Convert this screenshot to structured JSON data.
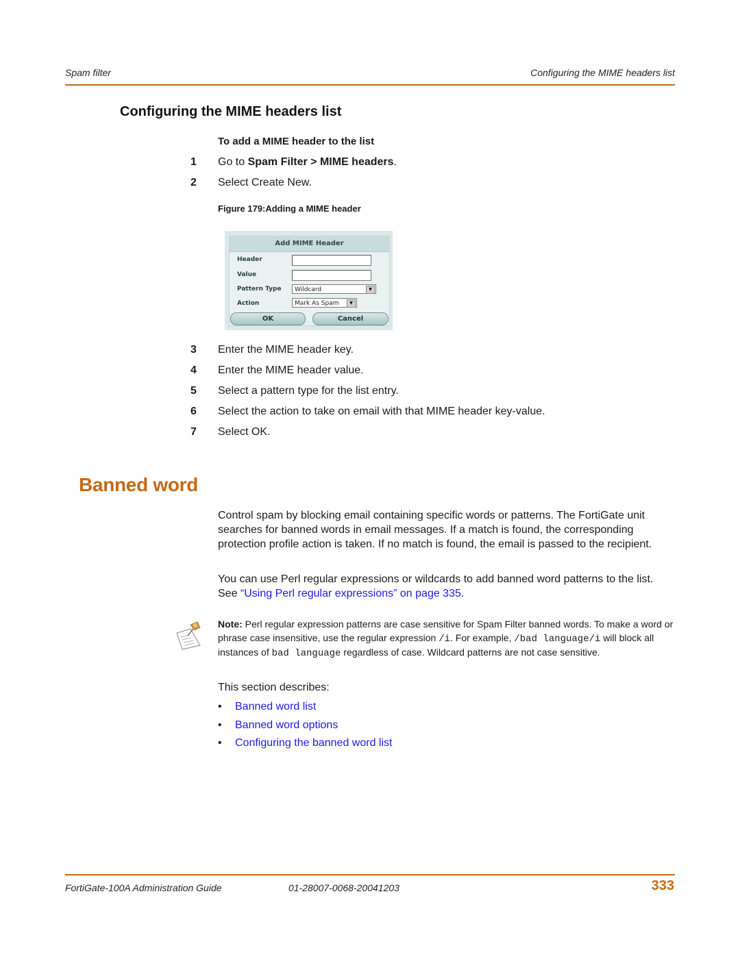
{
  "header": {
    "left": "Spam filter",
    "right": "Configuring the MIME headers list"
  },
  "section": {
    "title": "Configuring the MIME headers list",
    "procedure_title": "To add a MIME header to the list",
    "steps_before": [
      {
        "num": "1",
        "prefix": "Go to ",
        "bold": "Spam Filter > MIME headers",
        "suffix": "."
      },
      {
        "num": "2",
        "text": "Select Create New."
      }
    ],
    "figure_caption": "Figure 179:Adding a MIME header",
    "steps_after": [
      {
        "num": "3",
        "text": "Enter the MIME header key."
      },
      {
        "num": "4",
        "text": "Enter the MIME header value."
      },
      {
        "num": "5",
        "text": "Select a pattern type for the list entry."
      },
      {
        "num": "6",
        "text": "Select the action to take on email with that MIME header key-value."
      },
      {
        "num": "7",
        "text": "Select OK."
      }
    ]
  },
  "dialog": {
    "title": "Add MIME Header",
    "header_label": "Header",
    "header_value": "",
    "value_label": "Value",
    "value_value": "",
    "pattern_type_label": "Pattern Type",
    "pattern_type_selected": "Wildcard",
    "action_label": "Action",
    "action_selected": "Mark As Spam",
    "ok_label": "OK",
    "cancel_label": "Cancel",
    "dropdown_arrow": "▼"
  },
  "banned_word": {
    "title": "Banned word",
    "para1": "Control spam by blocking email containing specific words or patterns. The FortiGate unit searches for banned words in email messages. If a match is found, the corresponding protection profile action is taken. If no match is found, the email is passed to the recipient.",
    "para2_prefix": "You can use Perl regular expressions or wildcards to add banned word patterns to the list. See ",
    "para2_link": "“Using Perl regular expressions” on page 335",
    "para2_suffix": ".",
    "note": {
      "icon": "note-pin-icon",
      "label": "Note:",
      "text1": " Perl regular expression patterns are case sensitive for Spam Filter banned words. To make a word or phrase case insensitive, use the regular expression ",
      "code1": "/i",
      "text2": ". For example, ",
      "code2": "/bad language/i",
      "text3": " will block all instances of ",
      "code3": "bad language",
      "text4": " regardless of case. Wildcard patterns are not case sensitive."
    },
    "describes": "This section describes:",
    "bullets": [
      "Banned word list",
      "Banned word options",
      "Configuring the banned word list"
    ],
    "bullet_char": "•"
  },
  "footer": {
    "guide": "FortiGate-100A Administration Guide",
    "doc_id": "01-28007-0068-20041203",
    "page": "333"
  },
  "colors": {
    "accent": "#c46a12",
    "link": "#1a1ae6"
  }
}
